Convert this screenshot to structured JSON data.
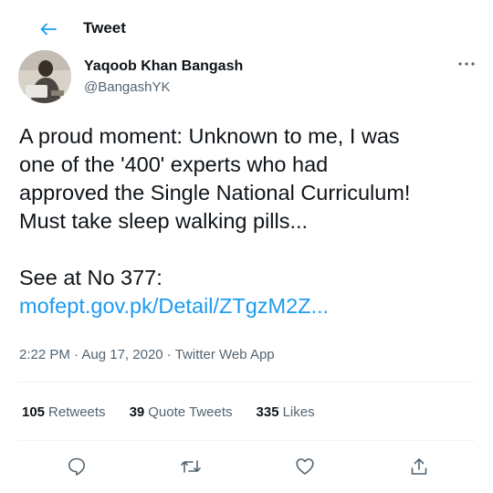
{
  "header": {
    "title": "Tweet",
    "back_icon": "arrow-left-icon"
  },
  "author": {
    "name": "Yaqoob Khan Bangash",
    "handle": "@BangashYK",
    "more_icon": "more-icon"
  },
  "tweet": {
    "line1": "A proud moment: Unknown to me, I was",
    "line2": "one of the '400' experts who had",
    "line3": "approved the Single National Curriculum!",
    "line4": "Must take sleep walking pills...",
    "line5": "See at No 377:",
    "link": "mofept.gov.pk/Detail/ZTgzM2Z..."
  },
  "meta": {
    "time": "2:22 PM",
    "sep1": " · ",
    "date": "Aug 17, 2020",
    "sep2": " · ",
    "app": "Twitter Web App"
  },
  "stats": {
    "retweets_count": "105",
    "retweets_label": "Retweets",
    "quotes_count": "39",
    "quotes_label": "Quote Tweets",
    "likes_count": "335",
    "likes_label": "Likes"
  },
  "actions": [
    "reply-icon",
    "retweet-icon",
    "like-icon",
    "share-icon"
  ],
  "colors": {
    "accent": "#1d9bf0",
    "text": "#0f1419",
    "secondary": "#536471",
    "divider": "#eff3f4"
  }
}
